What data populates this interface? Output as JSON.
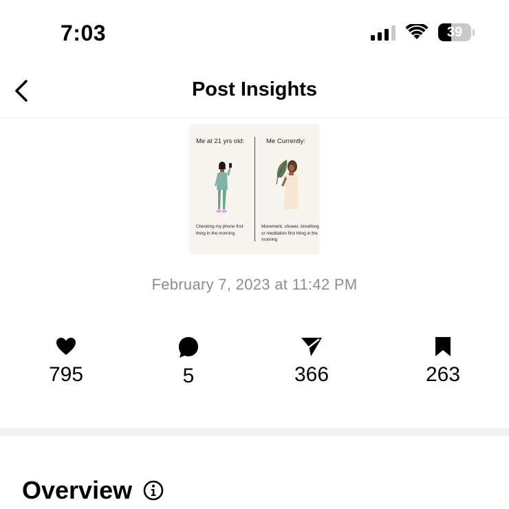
{
  "status_bar": {
    "time": "7:03",
    "battery_level": "39",
    "battery_fraction": 0.39,
    "icons": [
      "cellular-signal-icon",
      "wifi-icon",
      "battery-icon"
    ]
  },
  "header": {
    "title": "Post Insights",
    "back_icon": "chevron-left-icon"
  },
  "post": {
    "left_caption_top": "Me at 21 yrs old:",
    "right_caption_top": "Me Currently:",
    "left_caption_bottom": "Checking my phone first thing in the morning",
    "right_caption_bottom": "Movement, shower, breathing or meditation first thing in the morning",
    "date": "February 7, 2023 at 11:42 PM"
  },
  "metrics": {
    "likes": "795",
    "comments": "5",
    "shares": "366",
    "saves": "263"
  },
  "section": {
    "title": "Overview",
    "info_icon": "info-icon"
  },
  "colors": {
    "date_text": "#8a8d93",
    "thumb_bg": "#f8f4ef",
    "band": "#f2f2f2"
  }
}
